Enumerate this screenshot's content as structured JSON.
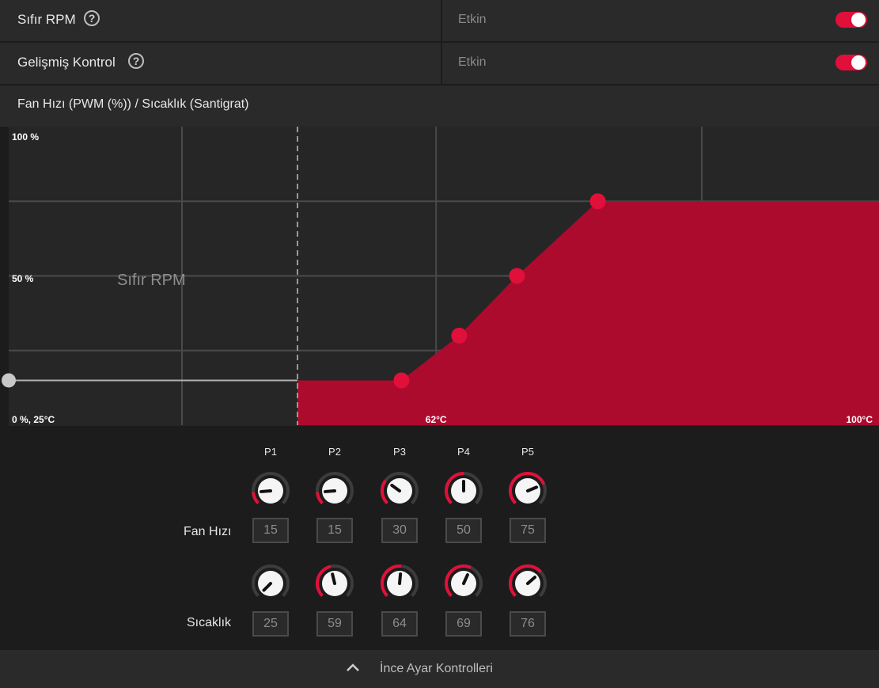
{
  "settings": [
    {
      "label": "Sıfır RPM",
      "value": "Etkin",
      "enabled": true
    },
    {
      "label": "Gelişmiş Kontrol",
      "value": "Etkin",
      "enabled": true
    }
  ],
  "help_glyph": "?",
  "chart_header": "Fan Hızı (PWM (%)) / Sıcaklık (Santigrat)",
  "chart_data": {
    "type": "area",
    "xlabel": "",
    "ylabel": "",
    "xlim": [
      25,
      100
    ],
    "ylim": [
      0,
      100
    ],
    "y_tick_labels": {
      "top": "100 %",
      "mid": "50 %",
      "origin": "0 %, 25°C"
    },
    "x_tick_labels": {
      "mid": "62°C",
      "end": "100°C"
    },
    "zero_rpm_label": "Sıfır RPM",
    "zero_rpm_threshold_c": 50,
    "zero_rpm_handle": {
      "x": 25,
      "y": 15
    },
    "points": [
      {
        "name": "P1",
        "x": 25,
        "y": 15
      },
      {
        "name": "P2",
        "x": 59,
        "y": 15
      },
      {
        "name": "P3",
        "x": 64,
        "y": 30
      },
      {
        "name": "P4",
        "x": 69,
        "y": 50
      },
      {
        "name": "P5",
        "x": 76,
        "y": 75
      }
    ],
    "fill_color": "#ad0b2e",
    "point_color": "#e0103a",
    "grid": true
  },
  "controls": {
    "columns": [
      "P1",
      "P2",
      "P3",
      "P4",
      "P5"
    ],
    "fan_label": "Fan Hızı",
    "temp_label": "Sıcaklık",
    "fan_values": [
      "15",
      "15",
      "30",
      "50",
      "75"
    ],
    "temp_values": [
      "25",
      "59",
      "64",
      "69",
      "76"
    ],
    "fan_knob_pct": [
      0.15,
      0.15,
      0.3,
      0.5,
      0.75
    ],
    "temp_knob_pct": [
      0.0,
      0.45,
      0.52,
      0.59,
      0.68
    ]
  },
  "footer": {
    "label": "İnce Ayar Kontrolleri",
    "icon": "chevron-up-icon"
  },
  "colors": {
    "accent": "#e0103a",
    "panel": "#2a2a2a",
    "background": "#1c1c1c"
  }
}
